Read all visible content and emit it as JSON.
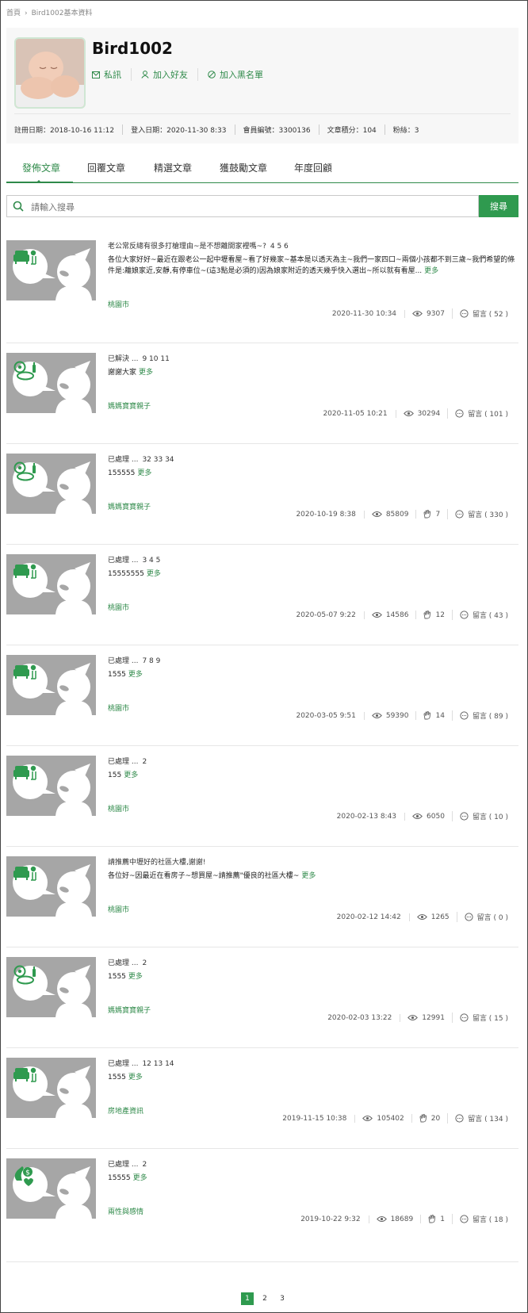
{
  "breadcrumb": {
    "home": "首頁",
    "current": "Bird1002基本資料"
  },
  "profile": {
    "username": "Bird1002",
    "actions": {
      "message": "私訊",
      "add_friend": "加入好友",
      "block": "加入黑名單"
    },
    "meta": [
      "註冊日期：2018-10-16 11:12",
      "登入日期：2020-11-30 8:33",
      "會員編號：3300136",
      "文章積分：104",
      "粉絲：3"
    ]
  },
  "tabs": [
    "發佈文章",
    "回覆文章",
    "精選文章",
    "獲鼓勵文章",
    "年度回顧"
  ],
  "search": {
    "placeholder": "請輸入搜尋",
    "button": "搜尋"
  },
  "more_label": "更多",
  "posts": [
    {
      "icon": "sofa-icon",
      "title": "老公常反總有很多打槍理由~是不想離開家裡嗎~?",
      "pages": "4  5  6",
      "excerpt": "各位大家好好~最近在跟老公一起中壢看屋~看了好幾家~基本是以透天為主~我們一家四口~兩個小孩都不到三歲~我們希望的條件是:離娘家近,安靜,有停車位~(這3點是必須的)因為娘家附近的透天幾乎快入選出~所以就有看屋...",
      "category": "桃園市",
      "date": "2020-11-30 10:34",
      "views": "9307",
      "likes": "",
      "comments": "留言 ( 52 )"
    },
    {
      "icon": "baby-icon",
      "title": "已解決  ...",
      "pages": "9  10  11",
      "excerpt": "謝謝大家",
      "category": "媽媽寶寶親子",
      "date": "2020-11-05 10:21",
      "views": "30294",
      "likes": "",
      "comments": "留言 ( 101 )"
    },
    {
      "icon": "baby-icon",
      "title": "已處理  ...",
      "pages": "32  33  34",
      "excerpt": "155555",
      "category": "媽媽寶寶親子",
      "date": "2020-10-19 8:38",
      "views": "85809",
      "likes": "7",
      "comments": "留言 ( 330 )"
    },
    {
      "icon": "sofa-icon",
      "title": "已處理  ...",
      "pages": "3  4  5",
      "excerpt": "15555555",
      "category": "桃園市",
      "date": "2020-05-07 9:22",
      "views": "14586",
      "likes": "12",
      "comments": "留言 ( 43 )"
    },
    {
      "icon": "sofa-icon",
      "title": "已處理  ...",
      "pages": "7  8  9",
      "excerpt": "1555",
      "category": "桃園市",
      "date": "2020-03-05 9:51",
      "views": "59390",
      "likes": "14",
      "comments": "留言 ( 89 )"
    },
    {
      "icon": "sofa-icon",
      "title": "已處理  ...",
      "pages": "2",
      "excerpt": "155",
      "category": "桃園市",
      "date": "2020-02-13 8:43",
      "views": "6050",
      "likes": "",
      "comments": "留言 ( 10 )"
    },
    {
      "icon": "sofa-icon",
      "title": "請推薦中壢好的社區大樓,謝謝!",
      "pages": "",
      "excerpt": "各位好~因最近在看房子~想買屋~請推薦\"優良的社區大樓~",
      "category": "桃園市",
      "date": "2020-02-12 14:42",
      "views": "1265",
      "likes": "",
      "comments": "留言 ( 0 )"
    },
    {
      "icon": "baby-icon",
      "title": "已處理  ...",
      "pages": "2",
      "excerpt": "1555",
      "category": "媽媽寶寶親子",
      "date": "2020-02-03 13:22",
      "views": "12991",
      "likes": "",
      "comments": "留言 ( 15 )"
    },
    {
      "icon": "sofa-icon",
      "title": "已處理  ...",
      "pages": "12  13  14",
      "excerpt": "1555",
      "category": "房地產資訊",
      "date": "2019-11-15 10:38",
      "views": "105402",
      "likes": "20",
      "comments": "留言 ( 134 )"
    },
    {
      "icon": "money-heart-icon",
      "title": "已處理  ...",
      "pages": "2",
      "excerpt": "15555",
      "category": "兩性與感情",
      "date": "2019-10-22 9:32",
      "views": "18689",
      "likes": "1",
      "comments": "留言 ( 18 )"
    }
  ],
  "pagination": {
    "pages": [
      "1",
      "2",
      "3"
    ],
    "current": "1"
  },
  "colors": {
    "accent": "#2f8a4a",
    "button": "#2f9a4f",
    "thumb_bg": "#a6a6a6"
  }
}
